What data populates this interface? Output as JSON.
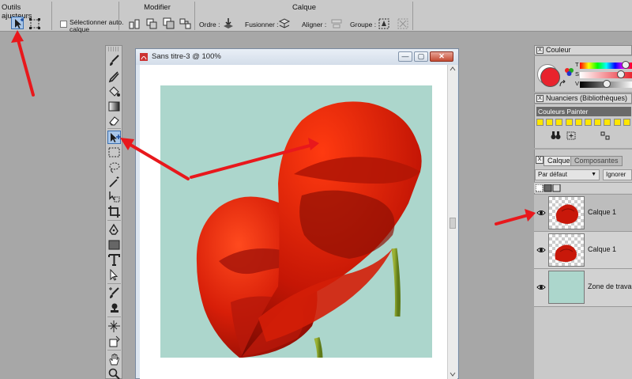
{
  "propbar": {
    "tools_title": "Outils ajusteurs",
    "select_auto_label": "Sélectionner auto.",
    "select_auto_label2": "calque",
    "modify_title": "Modifier",
    "layer_title": "Calque",
    "order_label": "Ordre :",
    "merge_label": "Fusionner :",
    "align_label": "Aligner :",
    "group_label": "Groupe :"
  },
  "document": {
    "title": "Sans titre-3 @ 100%",
    "minimize_glyph": "—",
    "maximize_glyph": "▢",
    "close_glyph": "✕"
  },
  "panels": {
    "color": {
      "title": "Couleur",
      "close": "X",
      "slider_labels": [
        "T",
        "S",
        "V"
      ],
      "values": [
        0.93,
        0.82,
        0.5
      ],
      "main_color": "#e8232d"
    },
    "swatches": {
      "title": "Nuanciers (Bibliothèques)",
      "close": "X",
      "library_name": "Couleurs Painter",
      "swatch_color": "#ffe600"
    },
    "layers": {
      "tab_layers": "Calques",
      "tab_components": "Composantes",
      "close": "X",
      "composite_method": "Par défaut",
      "preserve": "Ignorer",
      "items": [
        {
          "name": "Calque 1"
        },
        {
          "name": "Calque 1"
        },
        {
          "name": "Zone de travail"
        }
      ]
    }
  },
  "colors": {
    "canvas_bg": "#acd6cc",
    "poppy_red": "#d41e08",
    "annotation_arrow": "#e8181c"
  }
}
